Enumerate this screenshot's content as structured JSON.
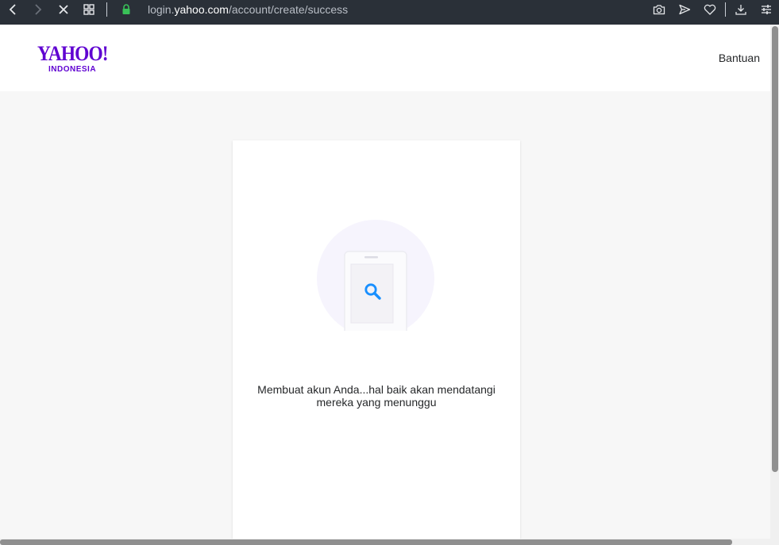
{
  "browser": {
    "url_prefix": "login.",
    "url_domain": "yahoo.com",
    "url_path": "/account/create/success"
  },
  "header": {
    "logo_text": "YAHOO!",
    "logo_subtext": "INDONESIA",
    "help_label": "Bantuan"
  },
  "card": {
    "message_line1": "Membuat akun Anda...hal baik akan mendatangi",
    "message_line2": "mereka yang menunggu"
  },
  "colors": {
    "brand": "#5f01d1",
    "search_icon": "#188fff",
    "toolbar_bg": "#2a3038"
  },
  "icons": [
    "back-icon",
    "forward-icon",
    "stop-icon",
    "tabs-grid-icon",
    "lock-icon",
    "camera-icon",
    "send-icon",
    "heart-icon",
    "download-icon",
    "settings-sliders-icon",
    "search-icon",
    "phone-icon"
  ]
}
